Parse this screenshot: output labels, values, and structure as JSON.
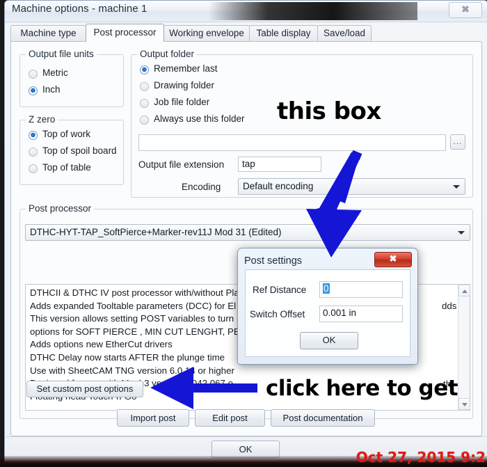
{
  "window": {
    "title": "Machine options - machine 1",
    "close_icon": "window-close-icon",
    "close_label": "✖"
  },
  "tabs": [
    {
      "label": "Machine type",
      "active": false
    },
    {
      "label": "Post processor",
      "active": true
    },
    {
      "label": "Working envelope",
      "active": false
    },
    {
      "label": "Table display",
      "active": false
    },
    {
      "label": "Save/load",
      "active": false
    }
  ],
  "output_file_units": {
    "legend": "Output file units",
    "options": [
      {
        "label": "Metric",
        "selected": false
      },
      {
        "label": "Inch",
        "selected": true
      }
    ]
  },
  "z_zero": {
    "legend": "Z zero",
    "options": [
      {
        "label": "Top of work",
        "selected": true
      },
      {
        "label": "Top of spoil board",
        "selected": false
      },
      {
        "label": "Top of table",
        "selected": false
      }
    ]
  },
  "output_folder": {
    "legend": "Output folder",
    "options": [
      {
        "label": "Remember last",
        "selected": true
      },
      {
        "label": "Drawing folder",
        "selected": false
      },
      {
        "label": "Job file folder",
        "selected": false
      },
      {
        "label": "Always use this folder",
        "selected": false
      }
    ],
    "path_value": "",
    "browse_label": "...",
    "extension_label": "Output file extension",
    "extension_value": "tap",
    "encoding_label": "Encoding",
    "encoding_value": "Default encoding"
  },
  "post_processor": {
    "legend": "Post processor",
    "selected": "DTHC-HYT-TAP_SoftPierce+Marker-rev11J Mod 31 (Edited)",
    "description_lines": [
      "DTHCII & DTHC IV post processor with/without Pla",
      "Adds expanded Tooltable parameters (DCC) for El",
      "This version allows setting POST variables to turn",
      "options for SOFT PIERCE ,  MIN CUT LENGHT, PEC",
      "Adds options new EtherCut drivers",
      "DTHC Delay now starts AFTER the plunge time",
      "Use with SheetCAM TNG version 6.0.14 or higher",
      "Designed for use with Mach3 version 3.042.067 o",
      "Floating head Touch-n-Go"
    ],
    "occluded_fragments": [
      "dds",
      "th"
    ],
    "buttons": {
      "set_custom": "Set custom post options",
      "import_post": "Import post",
      "edit_post": "Edit post",
      "post_documentation": "Post documentation"
    }
  },
  "footer": {
    "ok_label": "OK"
  },
  "dialog": {
    "title": "Post settings",
    "close_label": "✖",
    "close_icon": "dialog-close-icon",
    "ref_distance_label": "Ref Distance",
    "ref_distance_value": "0",
    "ref_distance_selected": true,
    "switch_offset_label": "Switch Offset",
    "switch_offset_value": "0.001 in",
    "ok_label": "OK"
  },
  "annotations": {
    "this_box": "this box",
    "click_here": "click here to get",
    "timestamp": "Oct 27, 2015 9:2",
    "arrow_color": "#1515d6",
    "timestamp_color": "#e01b12"
  }
}
